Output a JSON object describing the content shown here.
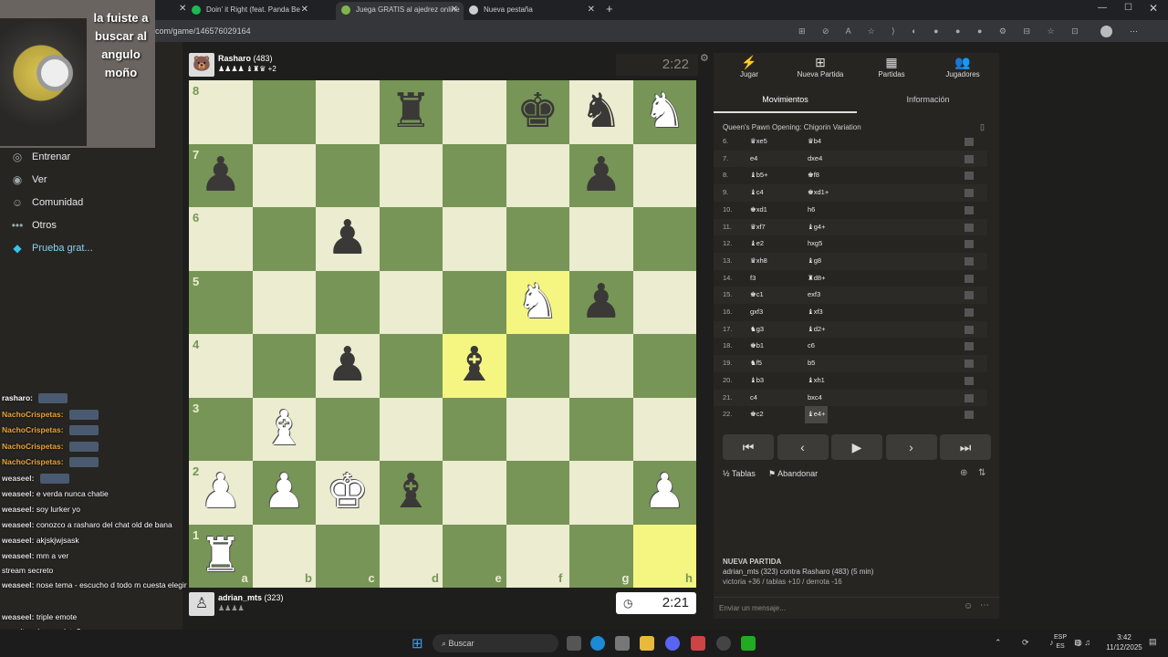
{
  "tabs": [
    {
      "label": "Doin' it Right (feat. Panda Be",
      "active": false
    },
    {
      "label": "Juega GRATIS al ajedrez online -",
      "active": true
    },
    {
      "label": "Nueva pestaña",
      "active": false
    }
  ],
  "url": "com/game/146576029164",
  "nav": [
    {
      "label": "Entrenar",
      "icon": "target-icon"
    },
    {
      "label": "Ver",
      "icon": "eye-icon"
    },
    {
      "label": "Comunidad",
      "icon": "people-icon"
    },
    {
      "label": "Otros",
      "icon": "dots-icon"
    },
    {
      "label": "Prueba grat...",
      "icon": "diamond-icon"
    }
  ],
  "overlay_text": "la fuiste a buscar al angulo moño",
  "chat": [
    {
      "user": "rasharo:",
      "text": ""
    },
    {
      "user": "NachoCrispetas:",
      "text": ""
    },
    {
      "user": "NachoCrispetas:",
      "text": ""
    },
    {
      "user": "NachoCrispetas:",
      "text": ""
    },
    {
      "user": "NachoCrispetas:",
      "text": ""
    },
    {
      "user": "weaseel:",
      "text": ""
    },
    {
      "user": "weaseel:",
      "text": "e verda nunca chatie"
    },
    {
      "user": "weaseel:",
      "text": "soy lurker yo"
    },
    {
      "user": "weaseel:",
      "text": "conozco a rasharo del chat old de bana"
    },
    {
      "user": "weaseel:",
      "text": "akjskjwjsask"
    },
    {
      "user": "weaseel:",
      "text": "mm a ver"
    },
    {
      "user": "",
      "text": "stream secreto"
    },
    {
      "user": "weaseel:",
      "text": "nose tema - escucho d todo m cuesta elegir"
    },
    {
      "user": "weaseel:",
      "text": "triple emote"
    },
    {
      "user": "",
      "text": "se soltara buena data?"
    }
  ],
  "top_player": {
    "name": "Rasharo",
    "rating": "(483)",
    "clock": "2:22",
    "extra": "+2"
  },
  "bottom_player": {
    "name": "adrian_mts",
    "rating": "(323)",
    "clock": "2:21"
  },
  "board": {
    "files": [
      "a",
      "b",
      "c",
      "d",
      "e",
      "f",
      "g",
      "h"
    ],
    "ranks": [
      "8",
      "7",
      "6",
      "5",
      "4",
      "3",
      "2",
      "1"
    ],
    "highlight": [
      "f5",
      "e4",
      "h1"
    ],
    "pieces": [
      {
        "sq": "d8",
        "p": "♜",
        "c": "b"
      },
      {
        "sq": "f8",
        "p": "♚",
        "c": "b"
      },
      {
        "sq": "g8",
        "p": "♞",
        "c": "b"
      },
      {
        "sq": "h8",
        "p": "♞",
        "c": "w"
      },
      {
        "sq": "a7",
        "p": "♟",
        "c": "b"
      },
      {
        "sq": "g7",
        "p": "♟",
        "c": "b"
      },
      {
        "sq": "c6",
        "p": "♟",
        "c": "b"
      },
      {
        "sq": "f5",
        "p": "♞",
        "c": "w"
      },
      {
        "sq": "g5",
        "p": "♟",
        "c": "b"
      },
      {
        "sq": "c4",
        "p": "♟",
        "c": "b"
      },
      {
        "sq": "e4",
        "p": "♝",
        "c": "b"
      },
      {
        "sq": "b3",
        "p": "♝",
        "c": "w"
      },
      {
        "sq": "a2",
        "p": "♟",
        "c": "w"
      },
      {
        "sq": "b2",
        "p": "♟",
        "c": "w"
      },
      {
        "sq": "c2",
        "p": "♚",
        "c": "w"
      },
      {
        "sq": "d2",
        "p": "♝",
        "c": "b"
      },
      {
        "sq": "h2",
        "p": "♟",
        "c": "w"
      },
      {
        "sq": "a1",
        "p": "♜",
        "c": "w"
      }
    ]
  },
  "panel": {
    "tabs": [
      {
        "label": "Jugar",
        "icon": "⚡"
      },
      {
        "label": "Nueva Partida",
        "icon": "⊞"
      },
      {
        "label": "Partidas",
        "icon": "▦"
      },
      {
        "label": "Jugadores",
        "icon": "👥"
      }
    ],
    "subtabs": [
      "Movimientos",
      "Información"
    ],
    "opening": "Queen's Pawn Opening: Chigorin Variation",
    "moves": [
      {
        "n": "6.",
        "w": "♛xe5",
        "b": "♛b4"
      },
      {
        "n": "7.",
        "w": "e4",
        "b": "dxe4"
      },
      {
        "n": "8.",
        "w": "♝b5+",
        "b": "♚f8"
      },
      {
        "n": "9.",
        "w": "♝c4",
        "b": "♚xd1+"
      },
      {
        "n": "10.",
        "w": "♚xd1",
        "b": "h6"
      },
      {
        "n": "11.",
        "w": "♛xf7",
        "b": "♝g4+"
      },
      {
        "n": "12.",
        "w": "♝e2",
        "b": "hxg5"
      },
      {
        "n": "13.",
        "w": "♛xh8",
        "b": "♝g8"
      },
      {
        "n": "14.",
        "w": "f3",
        "b": "♜d8+"
      },
      {
        "n": "15.",
        "w": "♚c1",
        "b": "exf3"
      },
      {
        "n": "16.",
        "w": "gxf3",
        "b": "♝xf3"
      },
      {
        "n": "17.",
        "w": "♞g3",
        "b": "♝d2+"
      },
      {
        "n": "18.",
        "w": "♚b1",
        "b": "c6"
      },
      {
        "n": "19.",
        "w": "♞f5",
        "b": "b5"
      },
      {
        "n": "20.",
        "w": "♝b3",
        "b": "♝xh1"
      },
      {
        "n": "21.",
        "w": "c4",
        "b": "bxc4"
      },
      {
        "n": "22.",
        "w": "♚c2",
        "b": "♝e4+"
      }
    ],
    "nav_buttons": [
      "⏮",
      "‹",
      "▶",
      "›",
      "⏭"
    ],
    "actions": {
      "draw": "½ Tablas",
      "resign": "Abandonar"
    },
    "new_game_title": "NUEVA PARTIDA",
    "new_game_players": "adrian_mts (323) contra Rasharo (483) (5 min)",
    "new_game_stats": "victoria +36 / tablas +10 / derrota -16",
    "chat_placeholder": "Enviar un mensaje..."
  },
  "taskbar": {
    "search": "Buscar",
    "lang": "ESP",
    "lang2": "ES",
    "time": "3:42",
    "date": "11/12/2025"
  }
}
